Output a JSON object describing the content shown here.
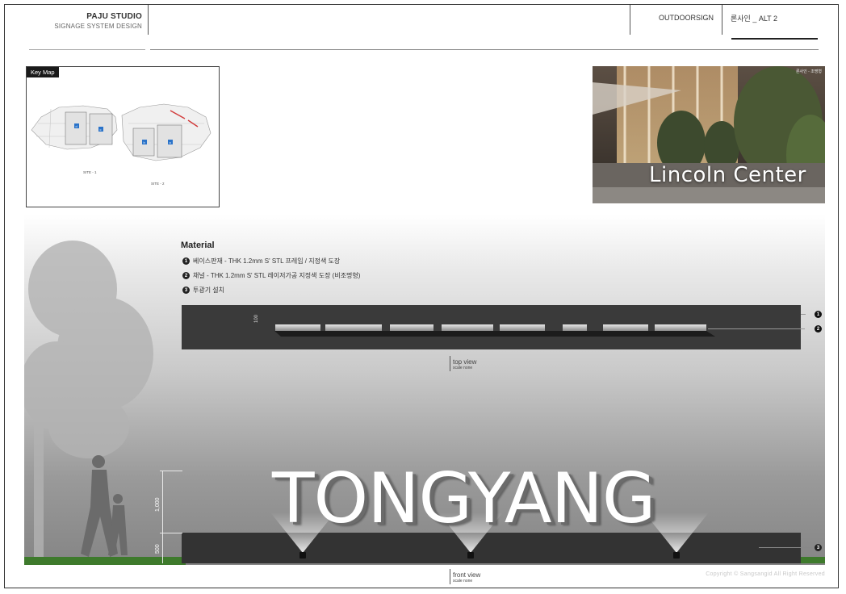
{
  "header": {
    "studio": "PAJU STUDIO",
    "subtitle": "SIGNAGE SYSTEM DESIGN",
    "category": "OUTDOORSIGN",
    "variant": "론사인 _ ALT 2"
  },
  "keymap": {
    "label": "Key Map",
    "site1": "SITE - 1",
    "site2": "SITE - 2",
    "markers": [
      "d",
      "c",
      "b",
      "a"
    ]
  },
  "photo": {
    "tag": "론사인 - 조명형",
    "caption": "Lincoln Center"
  },
  "material": {
    "title": "Material",
    "items": [
      {
        "num": "1",
        "text": "베이스판재 - THK 1.2mm S' STL 프레임 / 지정색 도장"
      },
      {
        "num": "2",
        "text": "채널 - THK 1.2mm S' STL 레이저가공 지정색 도장 (비조명형)"
      },
      {
        "num": "3",
        "text": "투광기 설치"
      }
    ]
  },
  "top_view": {
    "label": "top view",
    "scale": "scale none",
    "dimension": "100",
    "callouts": [
      "1",
      "2"
    ]
  },
  "front_view": {
    "sign_text": "TONGYANG",
    "label": "front view",
    "scale": "scale none",
    "dim_height": "1,000",
    "dim_base": "500",
    "callout": "3"
  },
  "copyright": "Copyright © Sangsangid All Right Reserved",
  "colors": {
    "base_dark": "#333333",
    "panel_light": "#ffffff",
    "panel_dark": "#858585",
    "marker_blue": "#2a73c9",
    "road_red": "#d23a3a"
  }
}
